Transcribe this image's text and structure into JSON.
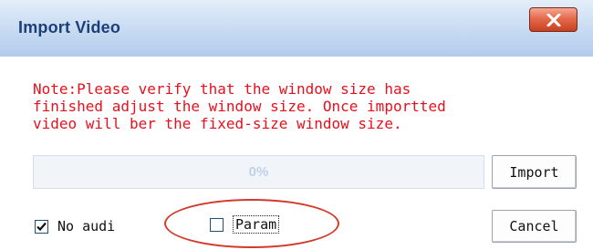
{
  "dialog": {
    "title": "Import Video",
    "close_symbol": "X"
  },
  "note": {
    "lines": [
      "Note:Please verify that the window size has",
      "finished adjust the window size. Once importted",
      "video will ber the fixed-size window size."
    ]
  },
  "progress": {
    "value_percent": 0,
    "label": "0%"
  },
  "buttons": {
    "import_label": "Import",
    "cancel_label": "Cancel"
  },
  "options": {
    "no_audio": {
      "label": "No audi",
      "checked": true
    },
    "param": {
      "label": "Param",
      "checked": false
    }
  },
  "colors": {
    "note_text": "#e8101c",
    "title_text": "#1c3f7a",
    "annotation_ellipse": "#d23a2a",
    "close_button": "#e46a4c"
  },
  "icons": {
    "close": "close-icon",
    "checkmark": "checkmark-icon"
  }
}
